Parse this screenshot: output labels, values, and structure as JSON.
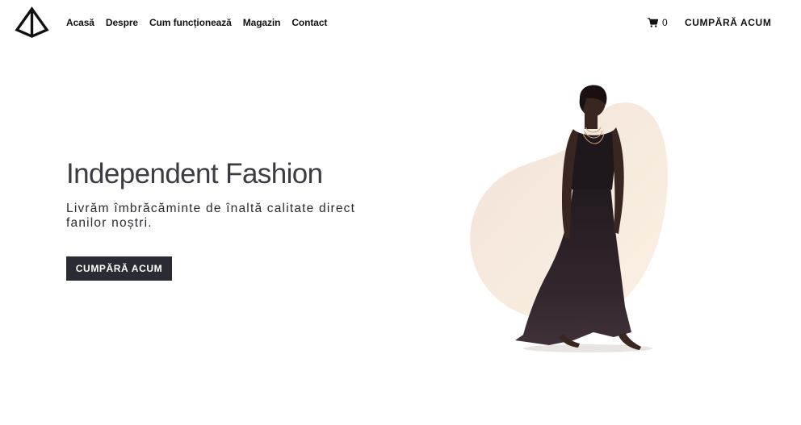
{
  "header": {
    "logo_icon": "pyramid-logo-icon",
    "nav": [
      {
        "label": "Acasă"
      },
      {
        "label": "Despre"
      },
      {
        "label": "Cum funcționează"
      },
      {
        "label": "Magazin"
      },
      {
        "label": "Contact"
      }
    ],
    "cart": {
      "icon": "cart-icon",
      "count": "0"
    },
    "cta_label": "CUMPĂRĂ ACUM"
  },
  "hero": {
    "title": "Independent Fashion",
    "subtitle": "Livrăm îmbrăcăminte de înaltă calitate direct fanilor noștri.",
    "cta_label": "CUMPĂRĂ ACUM",
    "image": {
      "subject": "model-in-black-dress",
      "blob_color": "#f3e6da"
    }
  },
  "colors": {
    "accent_dark": "#2b2b33",
    "text": "#1f1f24",
    "heading": "#3b3b44"
  }
}
